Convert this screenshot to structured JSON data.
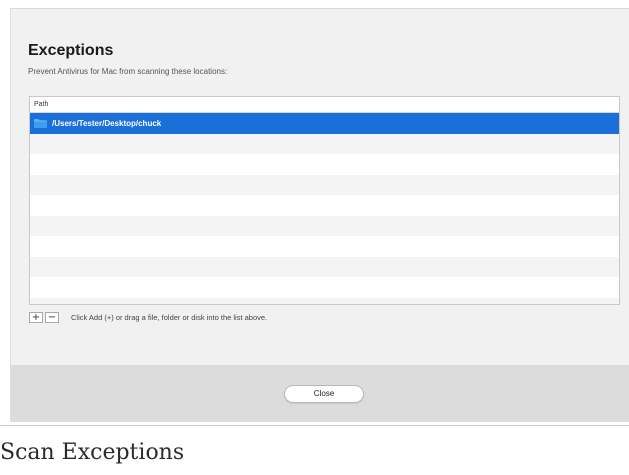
{
  "dialog": {
    "title": "Exceptions",
    "subtitle": "Prevent Antivirus for Mac from scanning these locations:"
  },
  "table": {
    "column_header": "Path",
    "rows": [
      {
        "path": "/Users/Tester/Desktop/chuck",
        "selected": true,
        "icon": "folder-icon"
      }
    ],
    "selection_color": "#1a6fd9"
  },
  "controls": {
    "add_label": "+",
    "remove_label": "−",
    "hint": "Click Add (+) or drag a file, folder or disk into the list above."
  },
  "footer": {
    "close_label": "Close"
  },
  "caption": "Scan Exceptions"
}
